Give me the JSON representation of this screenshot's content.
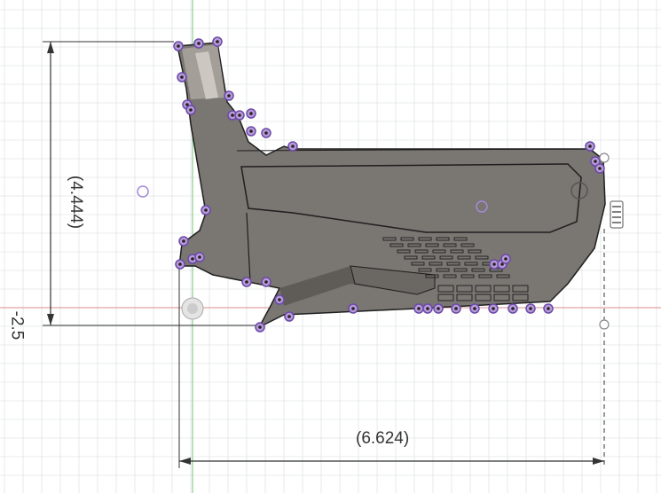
{
  "canvas": {
    "background": "#ffffff",
    "grid_minor_color": "#eef0f3",
    "grid_major_color": "#d6dade",
    "x_axis_color": "#d98b8b",
    "y_axis_color": "#8bcf8b"
  },
  "dimensions": {
    "vertical_label": "(4.444)",
    "negative_label": "-2.5",
    "horizontal_label": "(6.624)",
    "line_color": "#333333"
  },
  "part": {
    "fill_color": "#7a7672",
    "dark_fill_color": "#5f5b57",
    "edge_color": "#1f1f1f",
    "vertex_color": "#6a4aa8",
    "vertex_ring_color": "#b89ad8"
  },
  "icons": {
    "snap_handle": "snap-handle-icon",
    "origin": "origin-point-icon"
  }
}
